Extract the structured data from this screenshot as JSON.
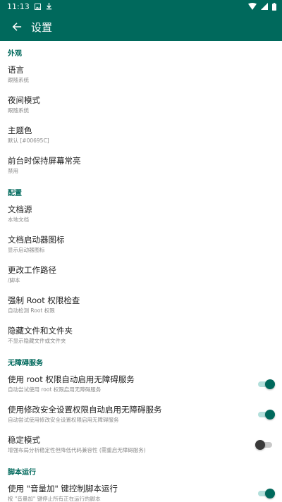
{
  "status_bar": {
    "time": "11:13"
  },
  "app_bar": {
    "title": "设置"
  },
  "sections": {
    "appearance": {
      "header": "外观",
      "items": [
        {
          "title": "语言",
          "summary": "跟随系统"
        },
        {
          "title": "夜间模式",
          "summary": "跟随系统"
        },
        {
          "title": "主题色",
          "summary": "默认 [#00695C]"
        },
        {
          "title": "前台时保持屏幕常亮",
          "summary": "禁用"
        }
      ]
    },
    "config": {
      "header": "配置",
      "items": [
        {
          "title": "文档源",
          "summary": "本地文档"
        },
        {
          "title": "文档启动器图标",
          "summary": "显示启动器图标"
        },
        {
          "title": "更改工作路径",
          "summary": "/脚本"
        },
        {
          "title": "强制 Root 权限检查",
          "summary": "自动检测 Root 权限"
        },
        {
          "title": "隐藏文件和文件夹",
          "summary": "不显示隐藏文件或文件夹"
        }
      ]
    },
    "accessibility": {
      "header": "无障碍服务",
      "items": [
        {
          "title": "使用 root 权限自动启用无障碍服务",
          "summary": "自动尝试使用 root 权限启用无障碍服务",
          "checked": true
        },
        {
          "title": "使用修改安全设置权限自动启用无障碍服务",
          "summary": "自动尝试使用修改安全设置权限启用无障碍服务",
          "checked": true
        },
        {
          "title": "稳定模式",
          "summary": "增强布局分析稳定性但降低代码兼容性 (需重启无障碍服务)",
          "checked": false
        }
      ]
    },
    "script_run": {
      "header": "脚本运行",
      "items": [
        {
          "title": "使用 \"音量加\" 键控制脚本运行",
          "summary": "按 \"音量加\" 键停止所有正在运行的脚本",
          "checked": true
        }
      ]
    }
  },
  "colors": {
    "primary": "#00695C",
    "switch_track_on": "#B2DFDB"
  }
}
